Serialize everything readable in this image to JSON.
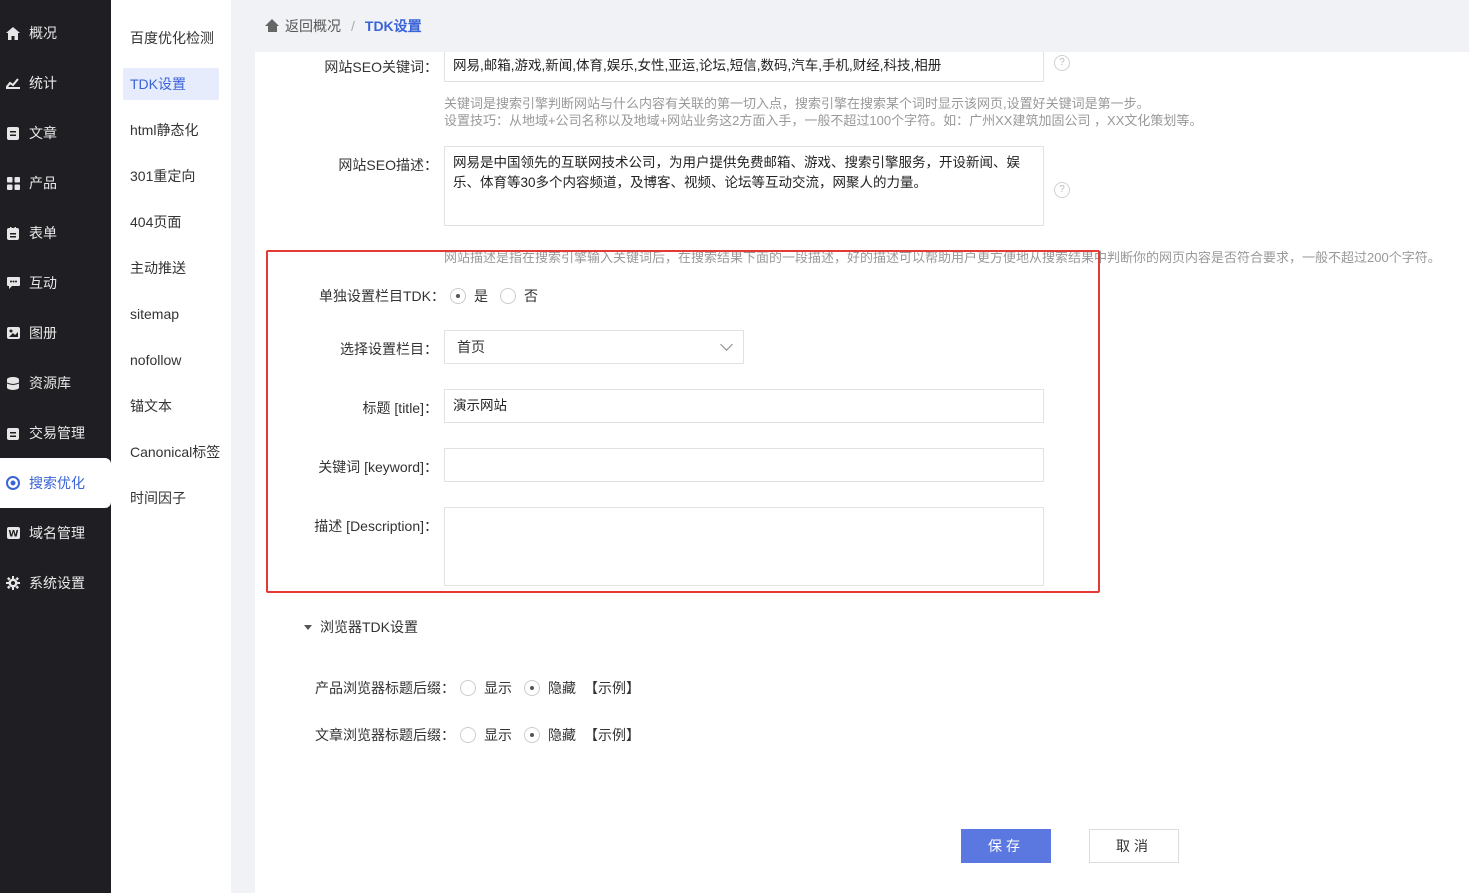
{
  "nav": {
    "items": [
      {
        "label": "概况",
        "icon": "home-icon"
      },
      {
        "label": "统计",
        "icon": "chart-icon"
      },
      {
        "label": "文章",
        "icon": "article-icon"
      },
      {
        "label": "产品",
        "icon": "grid-icon"
      },
      {
        "label": "表单",
        "icon": "form-icon"
      },
      {
        "label": "互动",
        "icon": "chat-icon"
      },
      {
        "label": "图册",
        "icon": "image-icon"
      },
      {
        "label": "资源库",
        "icon": "database-icon"
      },
      {
        "label": "交易管理",
        "icon": "trade-icon"
      },
      {
        "label": "搜索优化",
        "icon": "seo-icon"
      },
      {
        "label": "域名管理",
        "icon": "domain-icon"
      },
      {
        "label": "系统设置",
        "icon": "gear-icon"
      }
    ],
    "active_index": 9
  },
  "subnav": {
    "items": [
      "百度优化检测",
      "TDK设置",
      "html静态化",
      "301重定向",
      "404页面",
      "主动推送",
      "sitemap",
      "nofollow",
      "锚文本",
      "Canonical标签",
      "时间因子"
    ],
    "active_index": 1
  },
  "breadcrumb": {
    "back": "返回概况",
    "separator": "/",
    "current": "TDK设置"
  },
  "form": {
    "seo_keywords_label": "网站SEO关键词：",
    "seo_keywords_value": "网易,邮箱,游戏,新闻,体育,娱乐,女性,亚运,论坛,短信,数码,汽车,手机,财经,科技,相册",
    "seo_keywords_help_1": "关键词是搜索引擎判断网站与什么内容有关联的第一切入点，搜索引擎在搜索某个词时显示该网页,设置好关键词是第一步。",
    "seo_keywords_help_2": "设置技巧：从地域+公司名称以及地域+网站业务这2方面入手，一般不超过100个字符。如：广州XX建筑加固公司 ，XX文化策划等。",
    "seo_desc_label": "网站SEO描述：",
    "seo_desc_value": "网易是中国领先的互联网技术公司，为用户提供免费邮箱、游戏、搜索引擎服务，开设新闻、娱乐、体育等30多个内容频道，及博客、视频、论坛等互动交流，网聚人的力量。",
    "seo_desc_help": "网站描述是指在搜索引擎输入关键词后，在搜索结果下面的一段描述，好的描述可以帮助用户更方便地从搜索结果中判断你的网页内容是否符合要求，一般不超过200个字符。",
    "help_mark": "?",
    "column_tdk_label": "单独设置栏目TDK：",
    "yes": "是",
    "no": "否",
    "column_tdk_selected": "yes",
    "select_column_label": "选择设置栏目：",
    "select_column_value": "首页",
    "title_label": "标题 [title]：",
    "title_value": "演示网站",
    "keyword_label": "关键词 [keyword]：",
    "keyword_value": "",
    "description_label": "描述 [Description]：",
    "description_value": ""
  },
  "browser_tdk": {
    "section_title": "浏览器TDK设置",
    "product_label": "产品浏览器标题后缀：",
    "article_label": "文章浏览器标题后缀：",
    "show": "显示",
    "hide": "隐藏",
    "example": "【示例】",
    "product_selected": "hide",
    "article_selected": "hide"
  },
  "actions": {
    "save": "保存",
    "cancel": "取消"
  },
  "colors": {
    "accent": "#3a63d8",
    "primary_button": "#5a78e0",
    "highlight_border": "#e53935",
    "nav_bg": "#1f1f23"
  }
}
